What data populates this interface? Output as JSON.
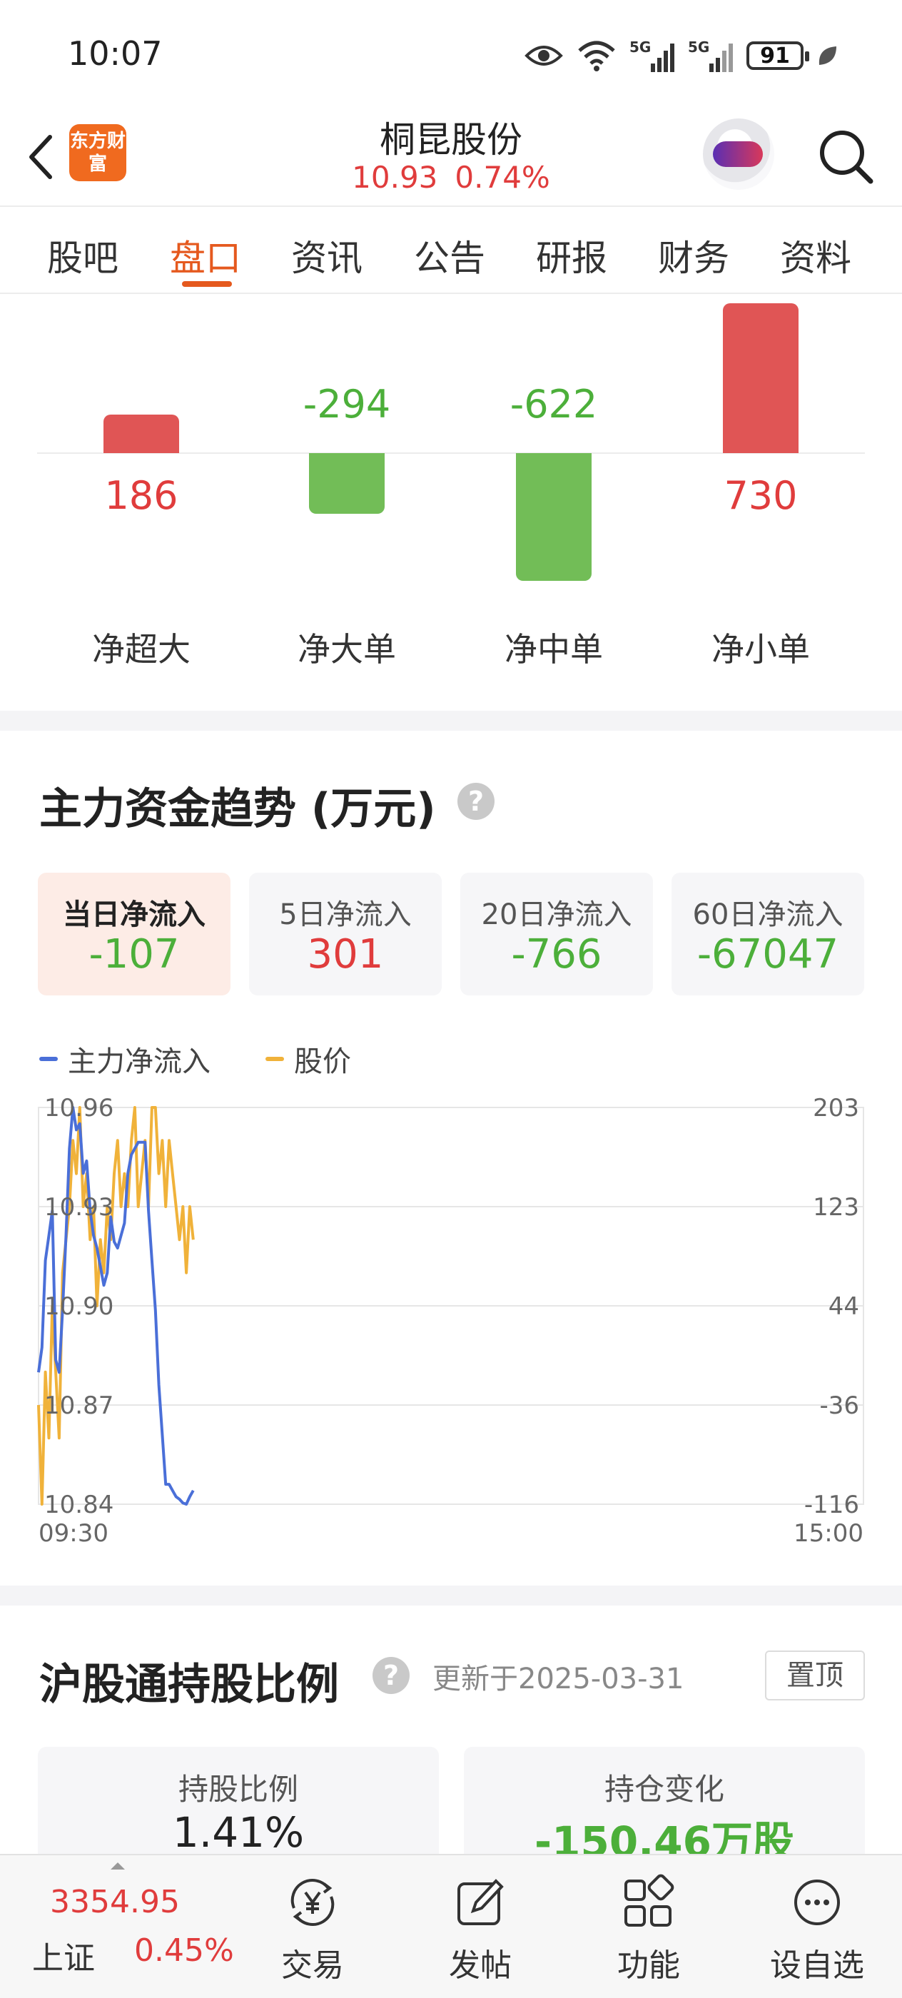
{
  "status_bar": {
    "time": "10:07",
    "battery": "91",
    "icons": [
      "eye-icon",
      "wifi-icon",
      "signal-5g-icon",
      "signal-5g-icon",
      "battery-icon",
      "leaf-icon"
    ]
  },
  "header": {
    "logo_text": "东方财富",
    "stock_name": "桐昆股份",
    "price": "10.93",
    "change_pct": "0.74%"
  },
  "tabs": [
    {
      "label": "股吧"
    },
    {
      "label": "盘口"
    },
    {
      "label": "资讯"
    },
    {
      "label": "公告"
    },
    {
      "label": "研报"
    },
    {
      "label": "财务"
    },
    {
      "label": "资料"
    }
  ],
  "active_tab": "盘口",
  "net_flow": {
    "items": [
      {
        "label": "净超大",
        "value": "186"
      },
      {
        "label": "净大单",
        "value": "-294"
      },
      {
        "label": "净中单",
        "value": "-622"
      },
      {
        "label": "净小单",
        "value": "730"
      }
    ],
    "colors": {
      "positive": "#e05555",
      "negative": "#72bd57"
    }
  },
  "trend": {
    "title": "主力资金趋势 (万元)",
    "help": "?",
    "cards": [
      {
        "label": "当日净流入",
        "value": "-107",
        "active": true
      },
      {
        "label": "5日净流入",
        "value": "301",
        "active": false
      },
      {
        "label": "20日净流入",
        "value": "-766",
        "active": false
      },
      {
        "label": "60日净流入",
        "value": "-67047",
        "active": false
      }
    ],
    "legend": [
      {
        "name": "主力净流入",
        "color": "#4a6fd8"
      },
      {
        "name": "股价",
        "color": "#f0b23a"
      }
    ]
  },
  "chart_data": {
    "type": "line",
    "x_start_label": "09:30",
    "x_end_label": "15:00",
    "left_axis_ticks": [
      "10.96",
      "10.93",
      "10.90",
      "10.87",
      "10.84"
    ],
    "left_axis_range": [
      10.84,
      10.96
    ],
    "right_axis_ticks": [
      "203",
      "123",
      "44",
      "-36",
      "-116"
    ],
    "right_axis_range": [
      -116,
      203
    ],
    "grid": true,
    "series": [
      {
        "name": "主力净流入",
        "axis": "right",
        "color": "#4a6fd8",
        "x_minutes": [
          0,
          1,
          2,
          3,
          4,
          5,
          6,
          7,
          8,
          9,
          10,
          11,
          12,
          13,
          14,
          15,
          16,
          17,
          18,
          19,
          20,
          21,
          22,
          23,
          24,
          25,
          26,
          27,
          28,
          29,
          30,
          31,
          32,
          33,
          34,
          35,
          36,
          37,
          38,
          39,
          40,
          41,
          42,
          43,
          44,
          45
        ],
        "values": [
          -10,
          10,
          80,
          100,
          120,
          0,
          -10,
          40,
          100,
          170,
          203,
          185,
          190,
          150,
          160,
          120,
          100,
          90,
          75,
          60,
          70,
          115,
          95,
          90,
          100,
          110,
          150,
          165,
          170,
          175,
          175,
          175,
          120,
          80,
          40,
          -20,
          -60,
          -100,
          -100,
          -105,
          -110,
          -112,
          -115,
          -116,
          -110,
          -105
        ]
      },
      {
        "name": "股价",
        "axis": "left",
        "color": "#f0b23a",
        "x_minutes": [
          0,
          1,
          2,
          3,
          4,
          5,
          6,
          7,
          8,
          9,
          10,
          11,
          12,
          13,
          14,
          15,
          16,
          17,
          18,
          19,
          20,
          21,
          22,
          23,
          24,
          25,
          26,
          27,
          28,
          29,
          30,
          31,
          32,
          33,
          34,
          35,
          36,
          37,
          38,
          39,
          40,
          41,
          42,
          43,
          44,
          45
        ],
        "values": [
          10.87,
          10.84,
          10.88,
          10.86,
          10.9,
          10.88,
          10.86,
          10.91,
          10.92,
          10.93,
          10.95,
          10.94,
          10.96,
          10.93,
          10.94,
          10.92,
          10.93,
          10.9,
          10.92,
          10.91,
          10.93,
          10.92,
          10.94,
          10.95,
          10.93,
          10.94,
          10.93,
          10.95,
          10.96,
          10.93,
          10.94,
          10.95,
          10.93,
          10.96,
          10.97,
          10.94,
          10.95,
          10.93,
          10.95,
          10.94,
          10.93,
          10.92,
          10.93,
          10.91,
          10.93,
          10.92
        ]
      }
    ]
  },
  "hk_connect": {
    "title": "沪股通持股比例",
    "help": "?",
    "updated": "更新于2025-03-31",
    "pin_label": "置顶",
    "cards": [
      {
        "label": "持股比例",
        "value": "1.41%"
      },
      {
        "label": "持仓变化",
        "value": "-150.46万股"
      }
    ]
  },
  "bottom_bar": {
    "index_value": "3354.95",
    "index_name": "上证",
    "index_change": "0.45%",
    "nav": [
      {
        "label": "交易",
        "icon": "yen-exchange-icon"
      },
      {
        "label": "发帖",
        "icon": "edit-icon"
      },
      {
        "label": "功能",
        "icon": "grid-icon"
      },
      {
        "label": "设自选",
        "icon": "more-icon"
      }
    ]
  }
}
